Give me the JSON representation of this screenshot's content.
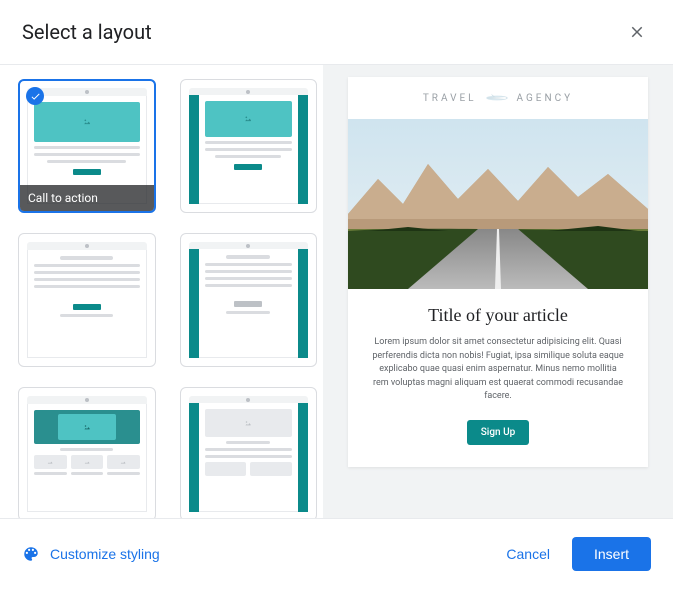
{
  "dialog": {
    "title": "Select a layout",
    "selected_index": 0,
    "cards": [
      {
        "label": "Call to action",
        "variant": "cta-teal"
      },
      {
        "label": "",
        "variant": "cta-sidebars"
      },
      {
        "label": "",
        "variant": "text-button"
      },
      {
        "label": "",
        "variant": "text-button-sidebars"
      },
      {
        "label": "",
        "variant": "hero-cols"
      },
      {
        "label": "",
        "variant": "plain-cols-sidebars"
      }
    ]
  },
  "preview": {
    "logo_left": "TRAVEL",
    "logo_right": "AGENCY",
    "article_title": "Title of your article",
    "article_body": "Lorem ipsum dolor sit amet consectetur adipisicing elit. Quasi perferendis dicta non nobis! Fugiat, ipsa similique soluta eaque explicabo quae quasi enim aspernatur. Minus nemo mollitia rem voluptas magni aliquam est quaerat commodi recusandae facere.",
    "cta_label": "Sign Up"
  },
  "footer": {
    "customize_label": "Customize styling",
    "cancel_label": "Cancel",
    "insert_label": "Insert"
  }
}
